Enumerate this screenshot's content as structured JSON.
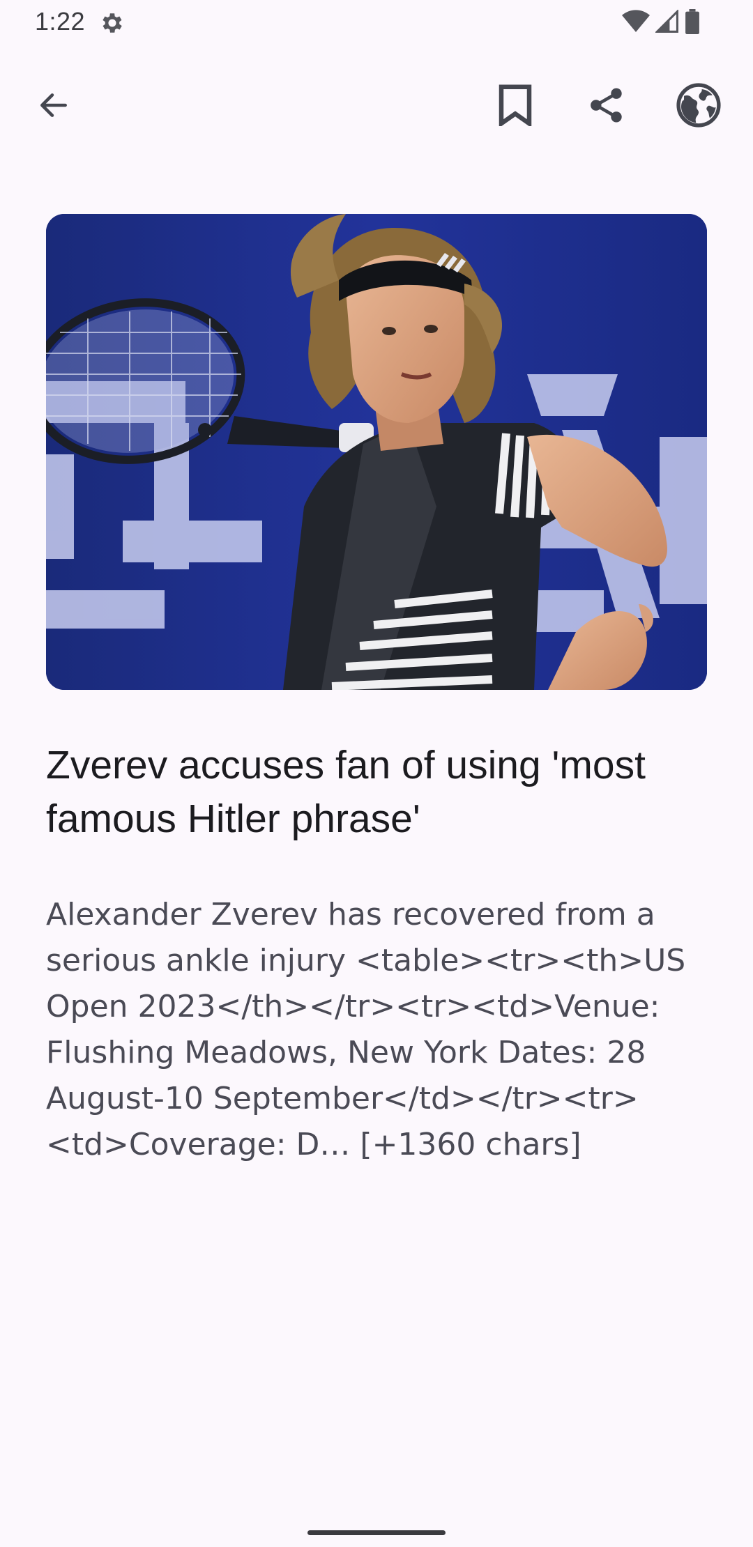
{
  "status_bar": {
    "time": "1:22",
    "icons": [
      "settings-gear-icon",
      "wifi-icon",
      "cellular-signal-icon",
      "battery-icon"
    ]
  },
  "toolbar": {
    "back_icon": "arrow-back-icon",
    "bookmark_icon": "bookmark-outline-icon",
    "share_icon": "share-icon",
    "browser_icon": "globe-icon"
  },
  "article": {
    "image_alt": "Tennis player swinging racket",
    "headline": "Zverev accuses fan of using 'most famous Hitler phrase'",
    "description": "Alexander Zverev has recovered from a serious ankle injury <table><tr><th>US Open 2023</th></tr><tr><td>Venue: Flushing Meadows, New York Dates: 28 August-10 September</td></tr><tr><td>Coverage: D… [+1360 chars]"
  },
  "colors": {
    "background": "#fcf8fd",
    "icon": "#44464f",
    "headline": "#1b1b1f",
    "description": "#4a4a55"
  }
}
